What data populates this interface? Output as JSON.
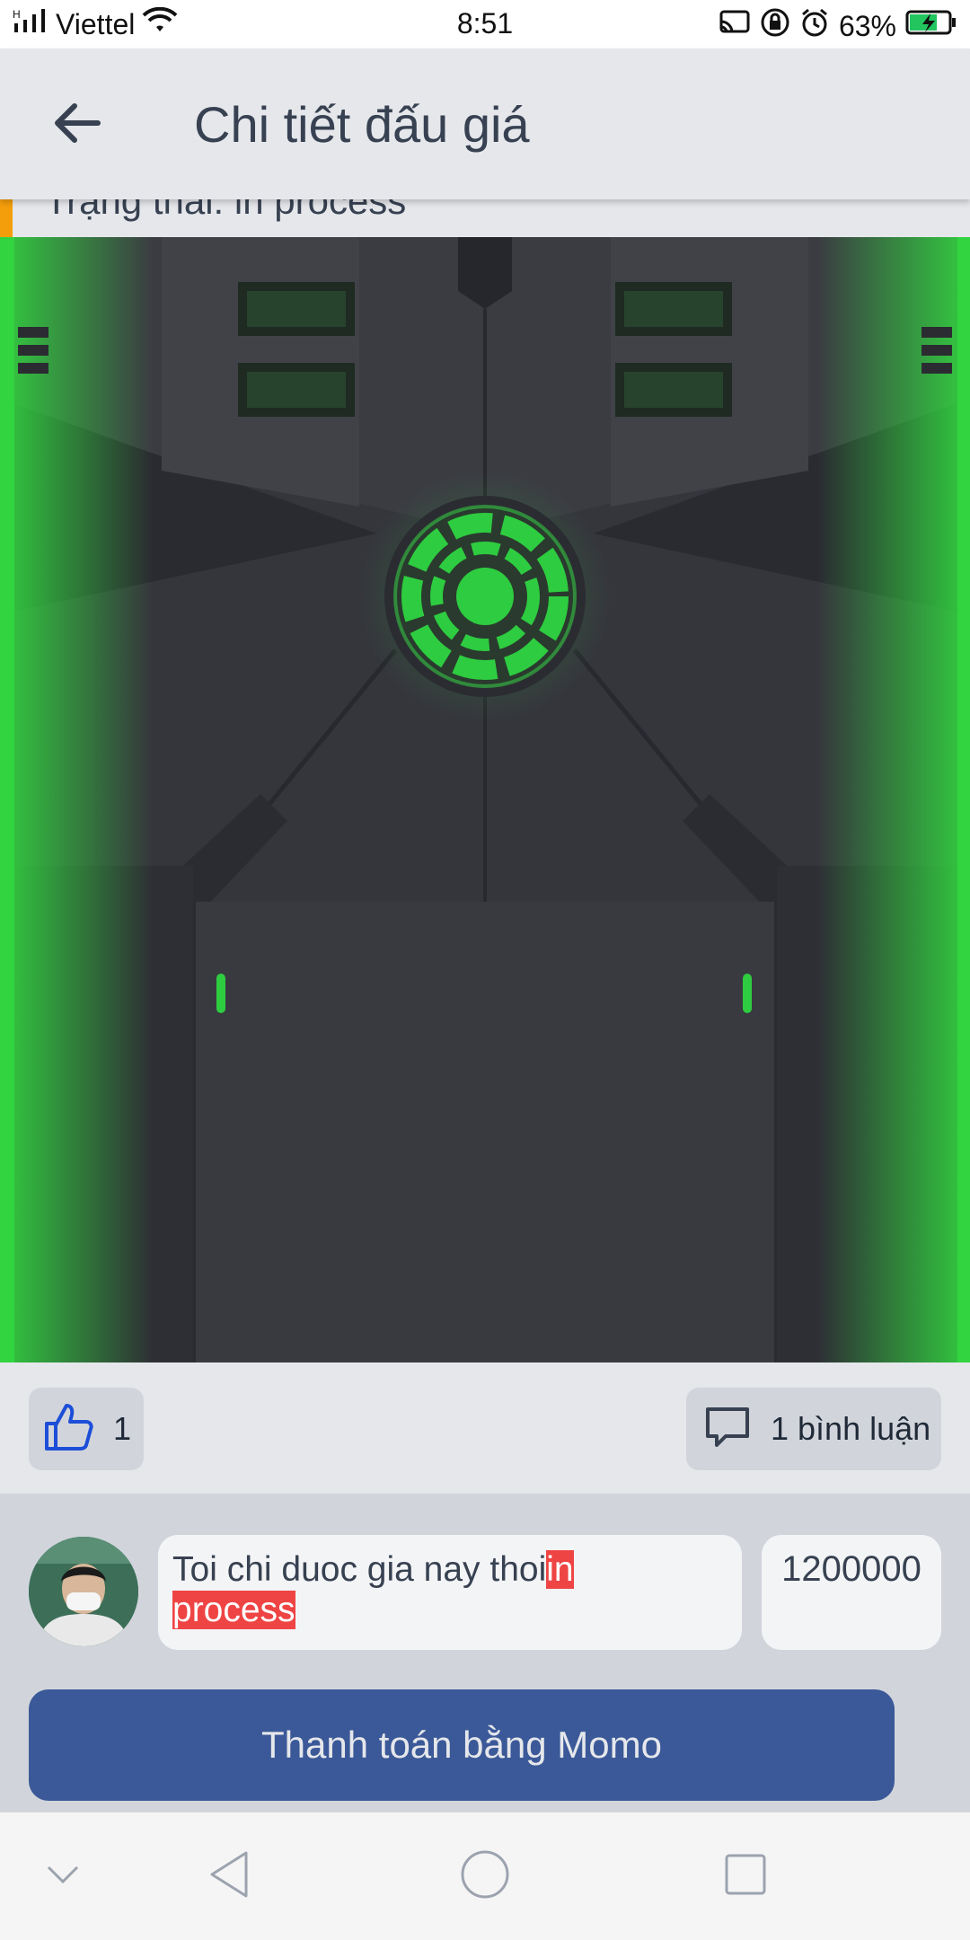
{
  "status_bar": {
    "carrier": "Viettel",
    "time": "8:51",
    "battery": "63%",
    "network_badge": "H"
  },
  "app_bar": {
    "title": "Chi tiết đấu giá"
  },
  "auction": {
    "status_text": "Trạng thái: in process"
  },
  "actions": {
    "like_count": "1",
    "comment_label": "1 bình luận"
  },
  "bid": {
    "comment_text": "Toi chi duoc gia nay thoi",
    "status_tag_1": "in",
    "status_tag_2": "process",
    "amount": "1200000"
  },
  "payment": {
    "button_label": "Thanh toán bằng Momo"
  },
  "colors": {
    "accent_blue": "#3b5998",
    "status_highlight": "#ef4444",
    "glow_green": "#2ecc40",
    "status_accent": "#f59e0b"
  }
}
